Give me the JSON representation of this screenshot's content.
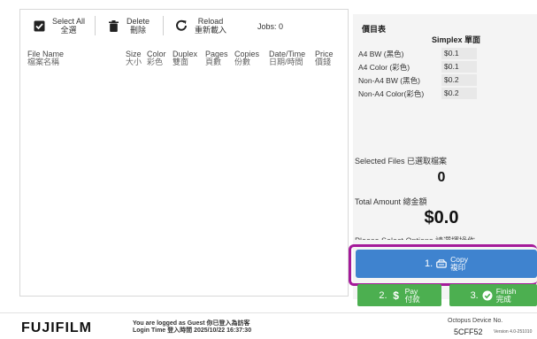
{
  "toolbar": {
    "select_all": [
      "Select All",
      "全選"
    ],
    "delete": [
      "Delete",
      "刪除"
    ],
    "reload": [
      "Reload",
      "重新載入"
    ],
    "jobs": "Jobs: 0"
  },
  "table": {
    "headers": [
      [
        "File Name",
        "檔案名稱"
      ],
      [
        "Size",
        "大小"
      ],
      [
        "Color",
        "彩色"
      ],
      [
        "Duplex",
        "雙面"
      ],
      [
        "Pages",
        "頁數"
      ],
      [
        "Copies",
        "份數"
      ],
      [
        "Date/Time",
        "日期/時間"
      ],
      [
        "Price",
        "價錢"
      ]
    ],
    "rows": []
  },
  "price_table": {
    "title": "價目表",
    "column": "Simplex 單面",
    "rows": [
      {
        "name": "A4 BW (黑色)",
        "value": "$0.1"
      },
      {
        "name": "A4 Color (彩色)",
        "value": "$0.1"
      },
      {
        "name": "Non-A4 BW (黑色)",
        "value": "$0.2"
      },
      {
        "name": "Non-A4 Color(彩色)",
        "value": "$0.2"
      }
    ]
  },
  "summary": {
    "selected_label": "Selected Files 已選取檔案",
    "selected_count": "0",
    "total_label": "Total Amount 總金額",
    "total_value": "$0.0",
    "prompt": "Please Select Options 請選擇操作"
  },
  "actions": {
    "copy": {
      "num": "1.",
      "label": [
        "Copy",
        "複印"
      ],
      "icon": "copier-icon"
    },
    "pay": {
      "num": "2.",
      "label": [
        "Pay",
        "付款"
      ],
      "icon": "dollar-icon"
    },
    "finish": {
      "num": "3.",
      "label": [
        "Finish",
        "完成"
      ],
      "icon": "check-circle-icon"
    }
  },
  "colors": {
    "copy": "#3f83cf",
    "pay": "#4caf50",
    "highlight": "#a51a9a"
  },
  "footer": {
    "brand": "FUJIFILM",
    "login_line1": "You are logged as Guest 你已登入為訪客",
    "login_line2": "Login Time 登入時間 2025/10/22 16:37:30",
    "device_label": "Octopus Device No.",
    "device_no": "5CFF52",
    "version": "Version 4.0-251010"
  }
}
